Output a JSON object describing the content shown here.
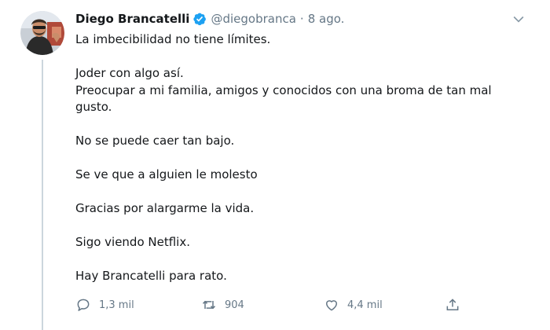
{
  "tweet": {
    "name": "Diego Brancatelli",
    "handle": "@diegobranca",
    "separator": "·",
    "date": "8 ago.",
    "lines": {
      "l1": "La imbecibilidad no tiene límites.",
      "l2": "Joder con algo así.",
      "l3a": "Preocupar a mi familia, amigos y conocidos con una broma de tan mal",
      "l3b": "gusto.",
      "l4": "No se puede caer tan bajo.",
      "l5": "Se ve que a alguien le molesto",
      "l6": "Gracias por alargarme la vida.",
      "l7": "Sigo viendo Netflix.",
      "l8": "Hay Brancatelli para rato."
    }
  },
  "actions": {
    "replies": "1,3 mil",
    "retweets": "904",
    "likes": "4,4 mil"
  },
  "colors": {
    "verified": "#1da1f2",
    "secondary_text": "#657786",
    "thread_line": "#ccd6dd"
  },
  "icons": [
    "verified-badge-icon",
    "chevron-down-icon",
    "reply-icon",
    "retweet-icon",
    "like-icon",
    "share-icon"
  ]
}
